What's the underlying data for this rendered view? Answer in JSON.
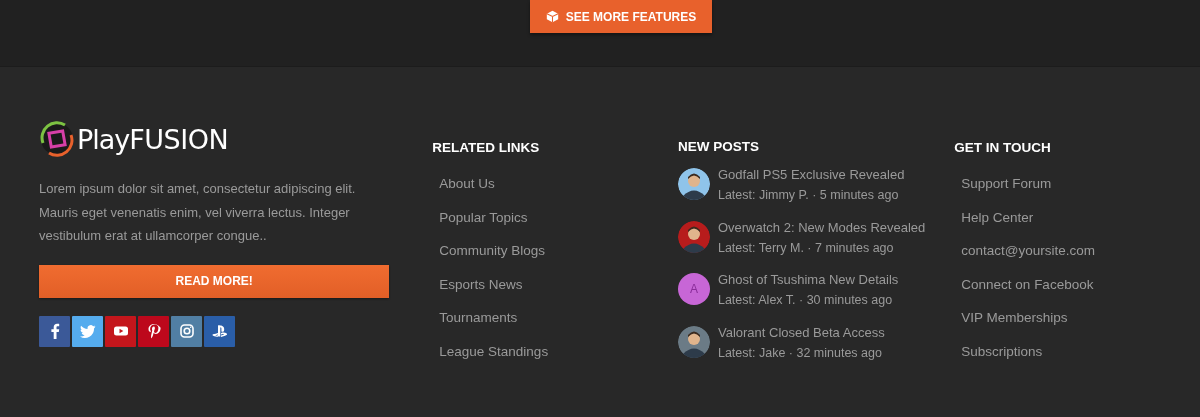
{
  "top_bar": {
    "button": "SEE MORE FEATURES"
  },
  "about": {
    "logo": {
      "prefix": "Play",
      "suffix": "FUSION"
    },
    "text": "Lorem ipsum dolor sit amet, consectetur adipiscing elit. Mauris eget venenatis enim, vel viverra lectus. Integer vestibulum erat at ullamcorper congue..",
    "button": "READ MORE!",
    "social": [
      {
        "kind": "facebook",
        "color": "#3b5998"
      },
      {
        "kind": "twitter",
        "color": "#55acee"
      },
      {
        "kind": "youtube",
        "color": "#c4161c"
      },
      {
        "kind": "pinterest",
        "color": "#bd081c"
      },
      {
        "kind": "instagram",
        "color": "#517fa4"
      },
      {
        "kind": "playstation",
        "color": "#2a5ea8"
      }
    ]
  },
  "related_links": {
    "title": "RELATED LINKS",
    "items": [
      "About Us",
      "Popular Topics",
      "Community Blogs",
      "Esports News",
      "Tournaments",
      "League Standings"
    ]
  },
  "new_posts": {
    "title": "NEW POSTS",
    "items": [
      {
        "title": "Godfall PS5 Exclusive Revealed",
        "meta": "Latest: Jimmy P. · 5 minutes ago"
      },
      {
        "title": "Overwatch 2: New Modes Revealed",
        "meta": "Latest: Terry M. · 7 minutes ago"
      },
      {
        "title": "Ghost of Tsushima New Details",
        "meta": "Latest: Alex T. · 30 minutes ago",
        "avatar": {
          "kind": "letter",
          "letter": "A",
          "color": "#c766d6"
        }
      },
      {
        "title": "Valorant Closed Beta Access",
        "meta": "Latest: Jake · 32 minutes ago"
      }
    ]
  },
  "get_in_touch": {
    "title": "GET IN TOUCH",
    "items": [
      "Support Forum",
      "Help Center",
      "contact@yoursite.com",
      "Connect on Facebook",
      "VIP Memberships",
      "Subscriptions"
    ]
  }
}
